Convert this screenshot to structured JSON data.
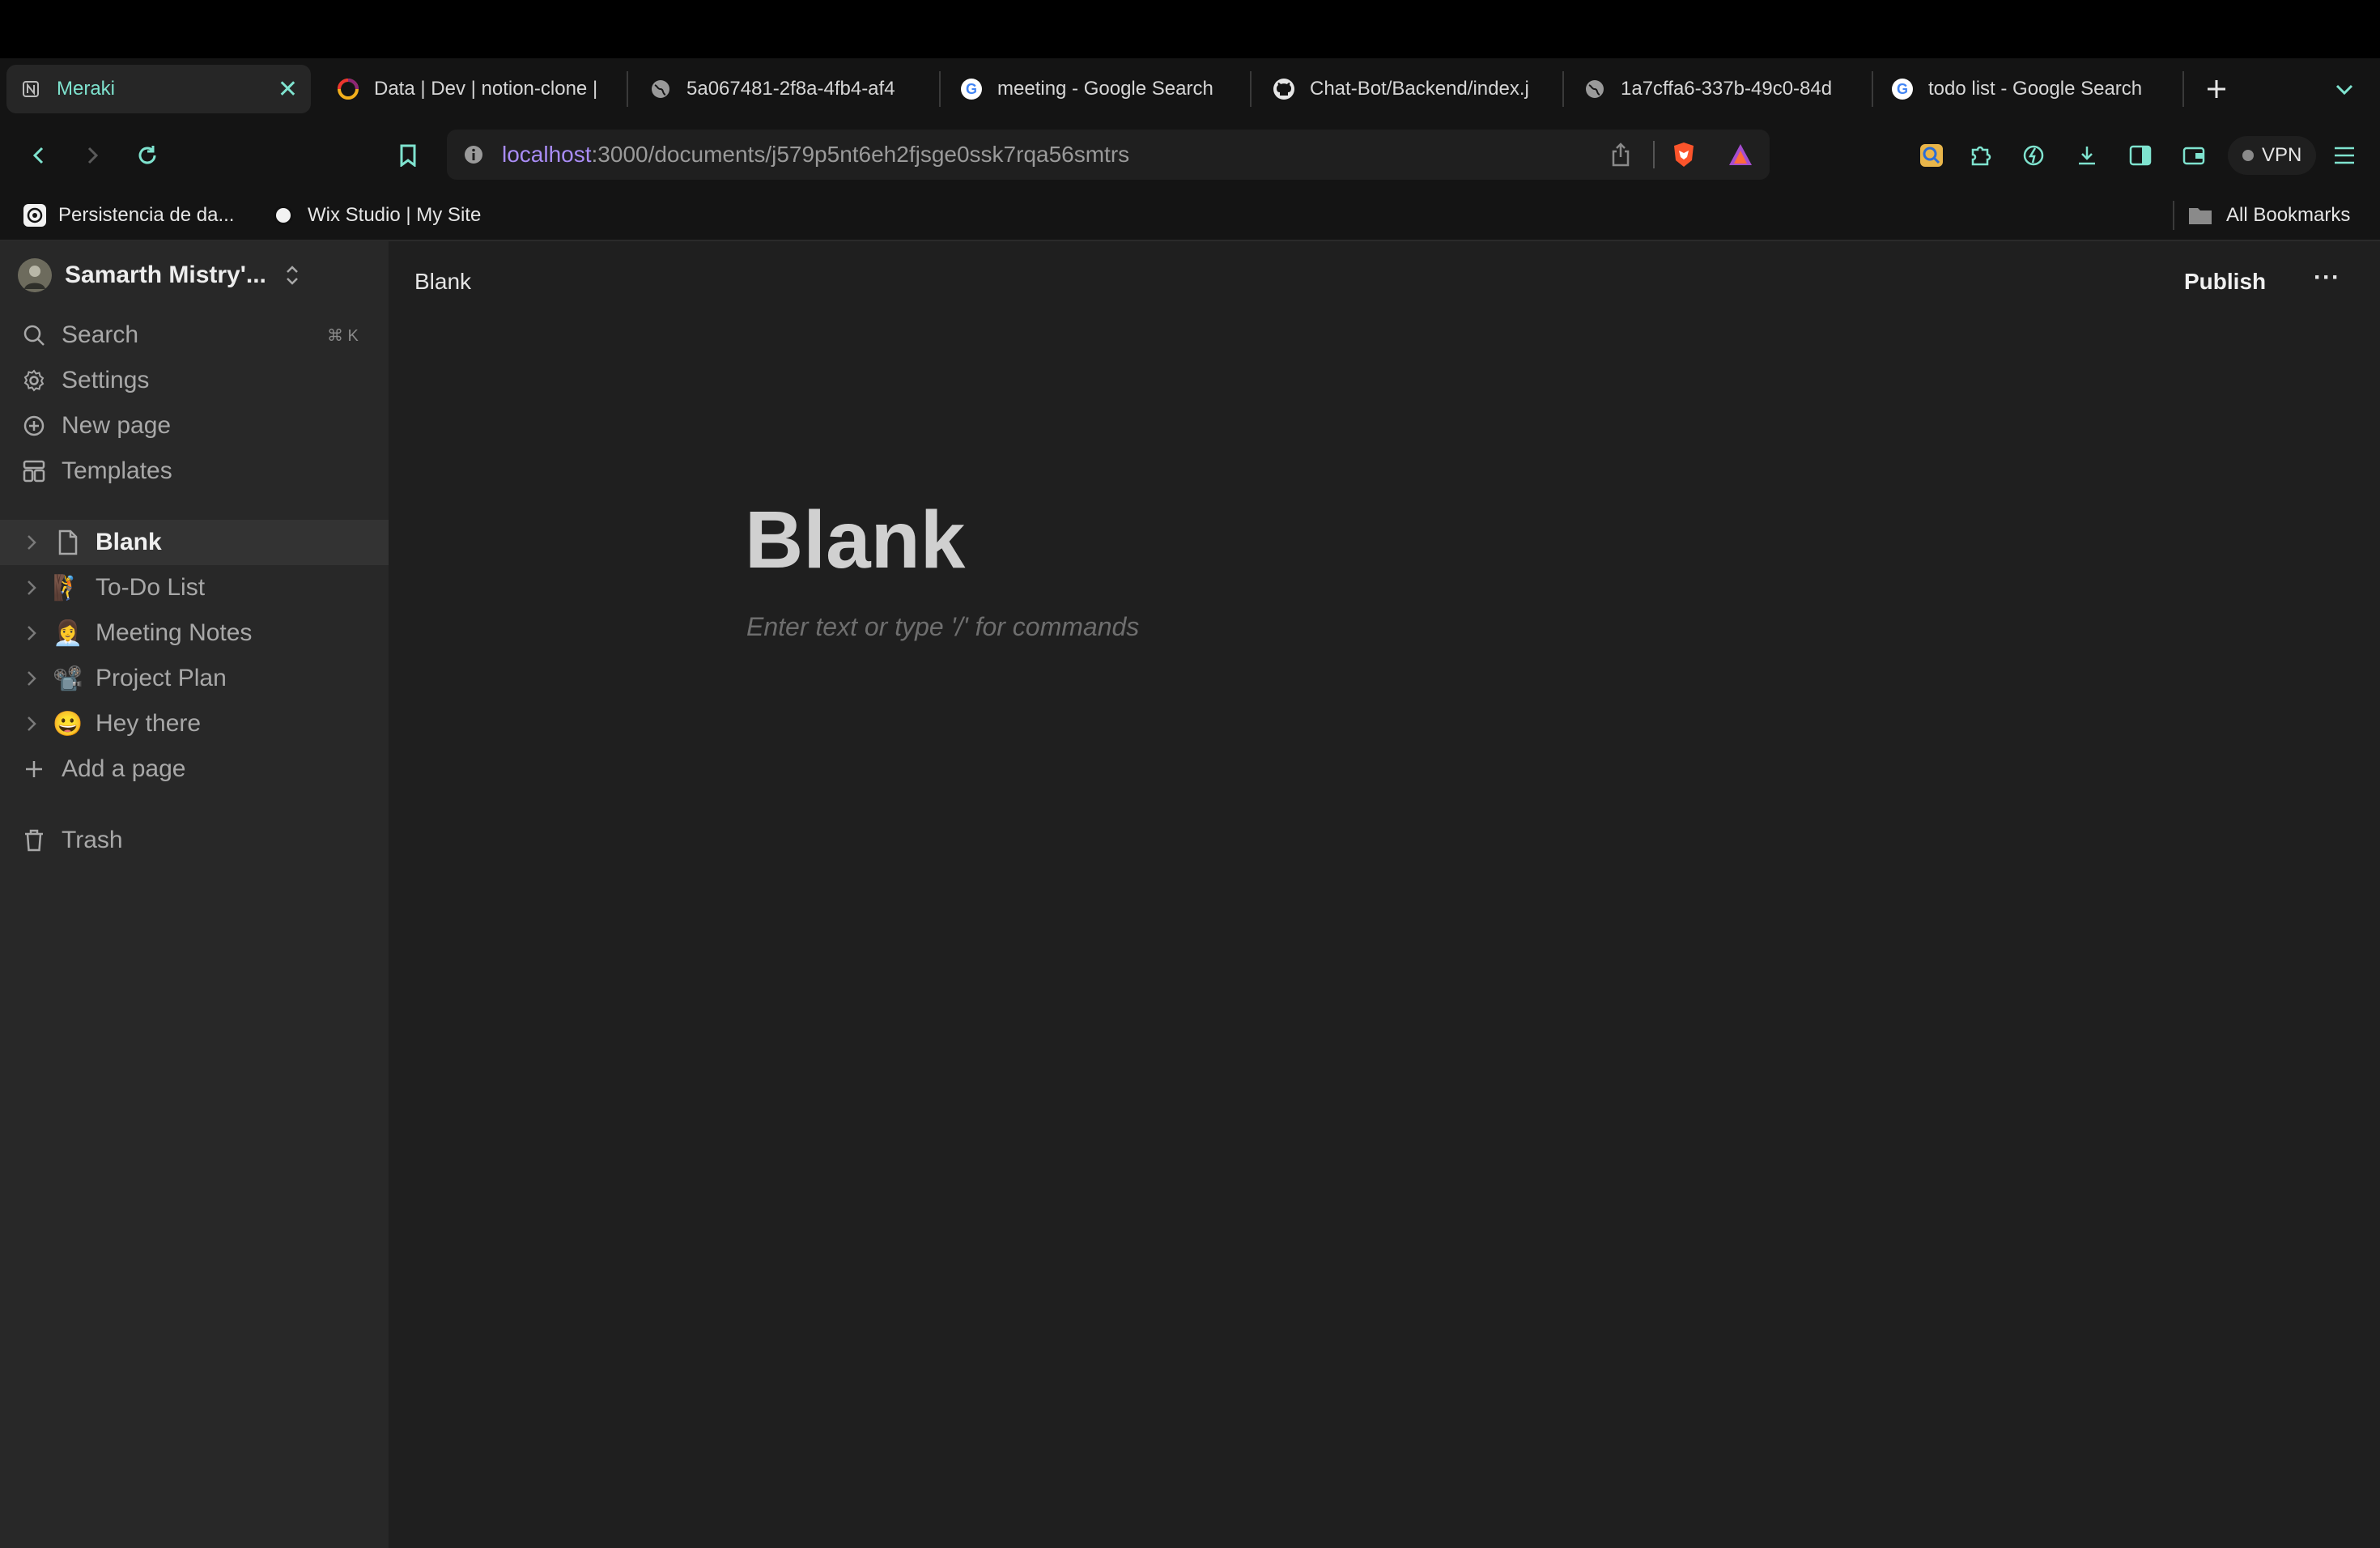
{
  "browser": {
    "tabs": [
      {
        "label": "Meraki",
        "active": true,
        "icon": "notion-icon"
      },
      {
        "label": "Data | Dev | notion-clone |",
        "icon": "convex-icon"
      },
      {
        "label": "5a067481-2f8a-4fb4-af4",
        "icon": "globe-icon"
      },
      {
        "label": "meeting - Google Search",
        "icon": "google-icon"
      },
      {
        "label": "Chat-Bot/Backend/index.j",
        "icon": "github-icon"
      },
      {
        "label": "1a7cffa6-337b-49c0-84d",
        "icon": "globe-icon"
      },
      {
        "label": "todo list - Google Search",
        "icon": "google-icon"
      }
    ],
    "url_host": "localhost",
    "url_path": ":3000/documents/j579p5nt6eh2fjsge0ssk7rqa56smtrs",
    "vpn_label": "VPN",
    "bookmarks": [
      {
        "label": "Persistencia de da..."
      },
      {
        "label": "Wix Studio | My Site"
      }
    ],
    "all_bookmarks_label": "All Bookmarks"
  },
  "sidebar": {
    "workspace_name": "Samarth Mistry'...",
    "search_label": "Search",
    "search_shortcut": "⌘ K",
    "settings_label": "Settings",
    "new_page_label": "New page",
    "templates_label": "Templates",
    "pages": [
      {
        "label": "Blank",
        "emoji": "📄",
        "active": true
      },
      {
        "label": "To-Do List",
        "emoji": "🧗"
      },
      {
        "label": "Meeting Notes",
        "emoji": "👩‍💼"
      },
      {
        "label": "Project Plan",
        "emoji": "📽️"
      },
      {
        "label": "Hey there",
        "emoji": "😀"
      }
    ],
    "add_page_label": "Add a page",
    "trash_label": "Trash"
  },
  "header": {
    "breadcrumb": "Blank",
    "publish_label": "Publish",
    "more_label": "···"
  },
  "document": {
    "title": "Blank",
    "placeholder": "Enter text or type '/' for commands"
  },
  "colors": {
    "accent": "#7fe3cf",
    "sidebar_bg": "#282828",
    "main_bg": "#1f1f1f"
  }
}
